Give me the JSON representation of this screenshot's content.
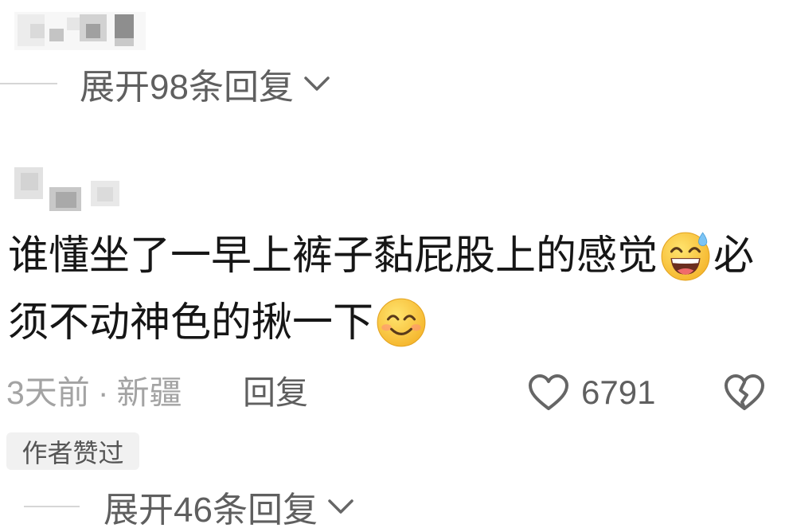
{
  "previous_comment": {
    "expand_replies": {
      "label": "展开98条回复",
      "icon": "chevron-down-icon"
    }
  },
  "comment": {
    "body": {
      "line1": {
        "text": "谁懂坐了一早上裤子黏屁股上的感觉",
        "emoji": "grinning-face-with-sweat-emoji",
        "text_after": "必"
      },
      "line2": {
        "text": "须不动神色的揪一下",
        "emoji": "smiling-face-with-smiling-eyes-emoji"
      }
    },
    "meta": {
      "time": "3天前",
      "separator": "·",
      "location": "新疆",
      "reply_label": "回复"
    },
    "like": {
      "icon": "heart-outline-icon",
      "count": "6791"
    },
    "dislike": {
      "icon": "broken-heart-icon"
    },
    "author_liked_badge": "作者赞过",
    "expand_replies": {
      "label": "展开46条回复",
      "icon": "chevron-down-icon"
    }
  },
  "colors": {
    "text_primary": "#161616",
    "text_secondary": "#5f5f5f",
    "text_muted": "#a3a3a3",
    "icon_color": "#666666",
    "divider": "#d6d6d6",
    "badge_bg": "#f1f1f1",
    "badge_text": "#555555",
    "background": "#ffffff"
  }
}
